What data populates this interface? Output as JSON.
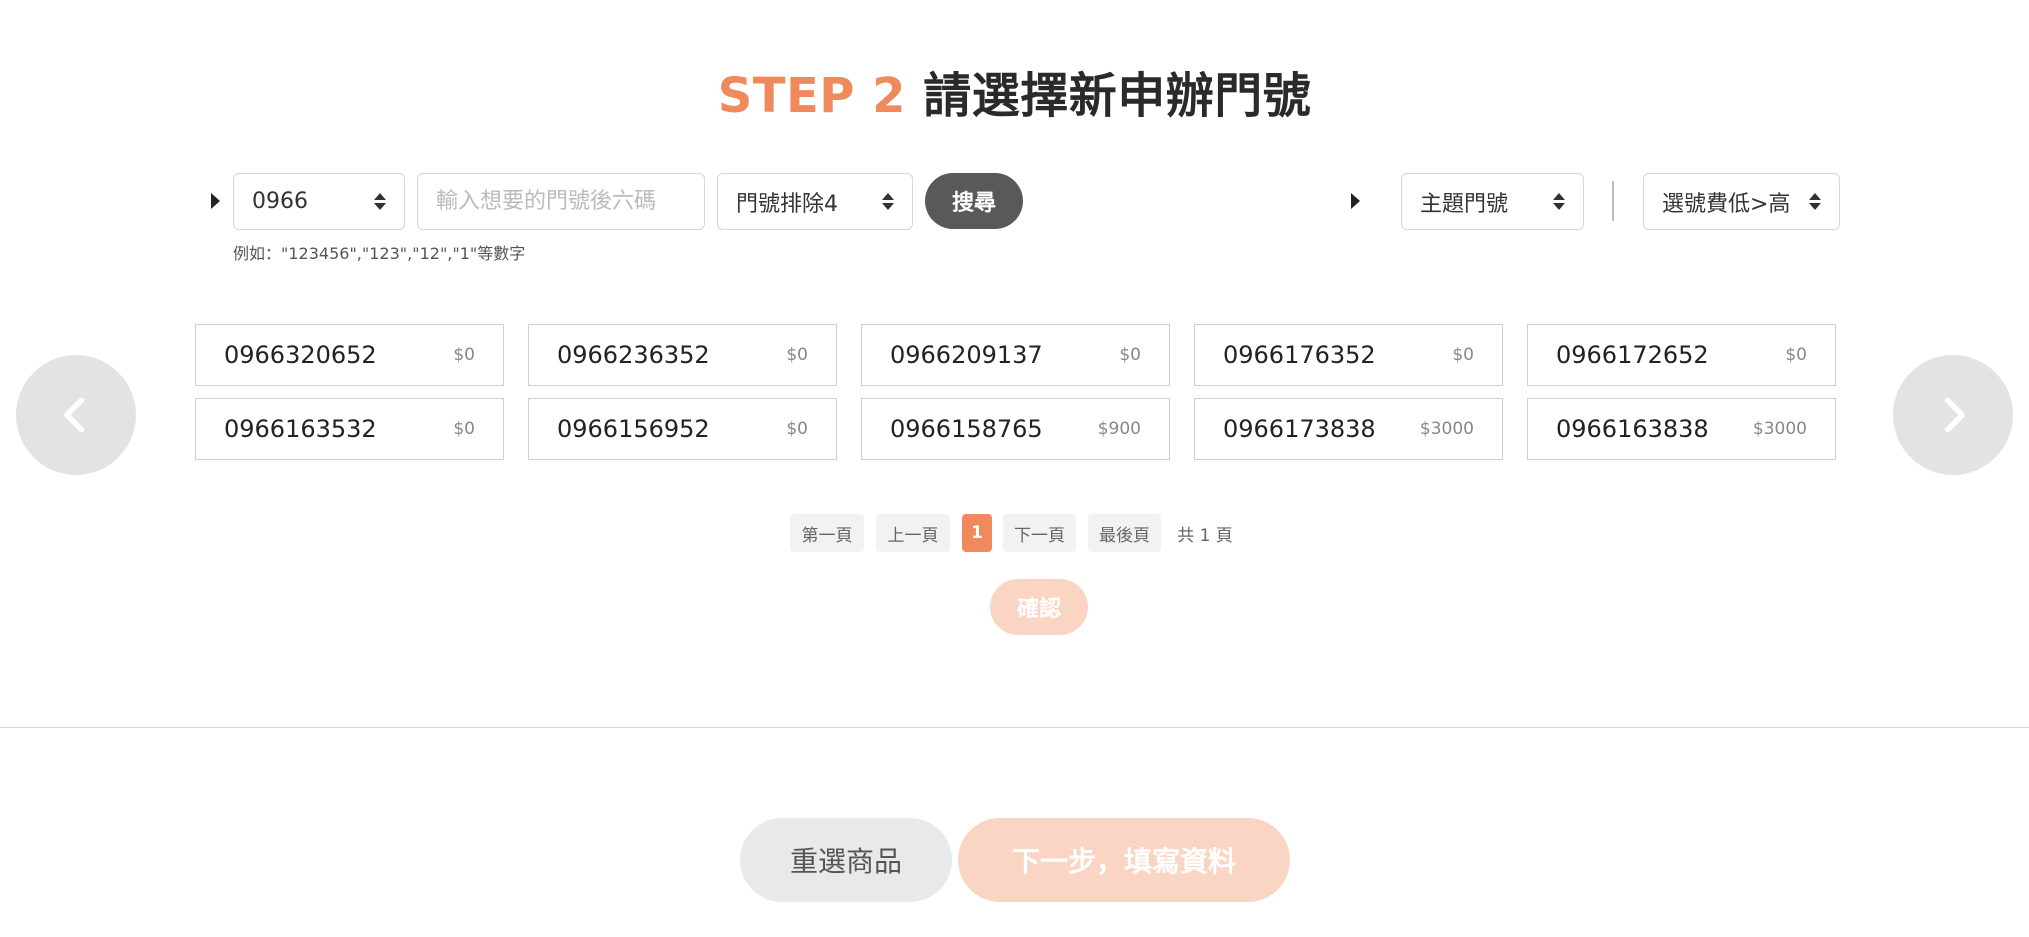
{
  "header": {
    "step_label": "STEP 2",
    "title": "請選擇新申辦門號"
  },
  "filters": {
    "prefix_select": "0966",
    "search_placeholder": "輸入想要的門號後六碼",
    "exclude_select": "門號排除4",
    "search_button": "搜尋",
    "theme_select": "主題門號",
    "sort_select": "選號費低>高",
    "hint": "例如：\"123456\",\"123\",\"12\",\"1\"等數字"
  },
  "numbers": [
    {
      "number": "0966320652",
      "price": "$0"
    },
    {
      "number": "0966236352",
      "price": "$0"
    },
    {
      "number": "0966209137",
      "price": "$0"
    },
    {
      "number": "0966176352",
      "price": "$0"
    },
    {
      "number": "0966172652",
      "price": "$0"
    },
    {
      "number": "0966163532",
      "price": "$0"
    },
    {
      "number": "0966156952",
      "price": "$0"
    },
    {
      "number": "0966158765",
      "price": "$900"
    },
    {
      "number": "0966173838",
      "price": "$3000"
    },
    {
      "number": "0966163838",
      "price": "$3000"
    }
  ],
  "pagination": {
    "first": "第一頁",
    "prev": "上一頁",
    "current": "1",
    "next": "下一頁",
    "last": "最後頁",
    "total": "共 1 頁"
  },
  "confirm_button": "確認",
  "footer": {
    "back_button": "重選商品",
    "next_button": "下一步，填寫資料"
  },
  "colors": {
    "accent": "#f08a5d",
    "accent_light": "#fbd5c4",
    "search_button": "#595959"
  }
}
